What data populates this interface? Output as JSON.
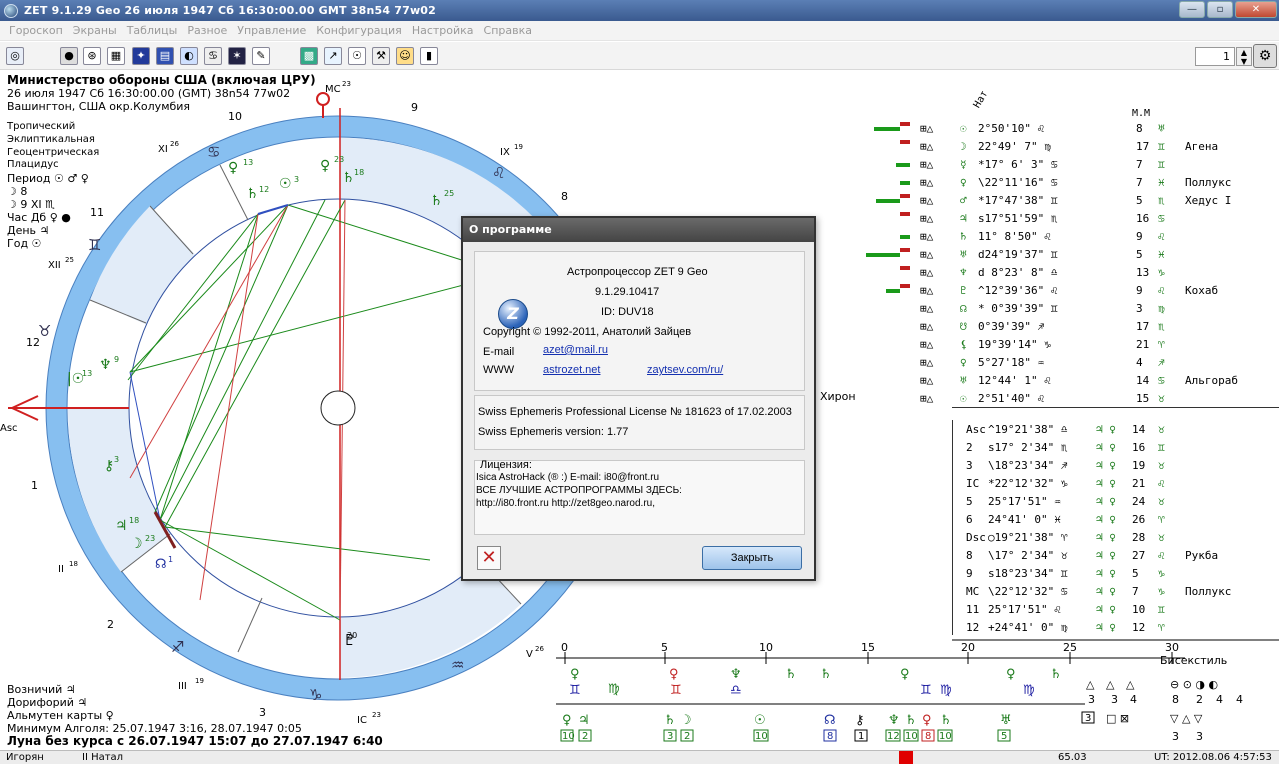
{
  "window": {
    "title": "ZET 9.1.29 Geo    26 июля 1947   Сб   16:30:00.00 GMT 38n54  77w02",
    "buttons": [
      "—",
      "▫",
      "✕"
    ]
  },
  "menu": [
    "Гороскоп",
    "Экраны",
    "Таблицы",
    "Разное",
    "Управление",
    "Конфигурация",
    "Настройка",
    "Справка"
  ],
  "toolbar": {
    "icons": [
      "chart-icon",
      "globe-icon",
      "wheel-icon",
      "grid-icon",
      "stars-icon",
      "table-icon",
      "transit-icon",
      "symbols-icon",
      "aspects-icon",
      "edit-icon",
      "aspect-grid-icon",
      "chart2-icon",
      "sun-icon",
      "tools-icon",
      "person-icon",
      "stats-icon"
    ],
    "page_value": "1"
  },
  "info": {
    "org": "Министерство обороны США (включая ЦРУ)",
    "date": "26 июля 1947  Сб  16:30:00.00 (GMT) 38n54  77w02",
    "place": "Вашингтон, США окр.Колумбия",
    "settings": [
      "Тропический",
      "Эклиптикальная",
      "Геоцентрическая",
      "Плацидус"
    ],
    "period": "Период ☉ ♂ ♀",
    "row1": "☽ 8",
    "row2": "☽ 9 XI ♏",
    "hour": "Час Дб ♀ ●",
    "day": "День ♃",
    "year": "Год ☉"
  },
  "bottom_info": {
    "l1": "Возничий ♃",
    "l2": "Дорифорий ♃",
    "l3": "Альмутен карты ♀",
    "l4": "Минимум Алголя: 25.07.1947  3:16, 28.07.1947  0:05",
    "l5": "Луна без курса с 26.07.1947 15:07 до 27.07.1947  6:40"
  },
  "wheel": {
    "house_numbers": [
      "10",
      "9",
      "8",
      "12",
      "1",
      "2",
      "3",
      "11"
    ],
    "cusps": [
      "MC23",
      "IX19",
      "XI26",
      "XII25",
      "II18",
      "III19",
      "IC23",
      "V26",
      "Asc"
    ],
    "side_label": "Хирон"
  },
  "right_table": {
    "header_nat": "Нат",
    "header_mm": "М.М",
    "rows": [
      {
        "sym": "☉",
        "pos": " 2°50'10\" ♌",
        "n": "8",
        "mark": "♅",
        "star": ""
      },
      {
        "sym": "☽",
        "pos": "22°49' 7\" ♍",
        "n": "17",
        "mark": "♊",
        "star": "Агена"
      },
      {
        "sym": "☿",
        "pos": "*17° 6' 3\" ♋",
        "n": "7",
        "mark": "♊",
        "star": ""
      },
      {
        "sym": "♀",
        "pos": "\\22°11'16\" ♋",
        "n": "7",
        "mark": "♓",
        "star": "Поллукс"
      },
      {
        "sym": "♂",
        "pos": "*17°47'38\" ♊",
        "n": "5",
        "mark": "♏",
        "star": "Хедус I"
      },
      {
        "sym": "♃",
        "pos": "s17°51'59\" ♏",
        "n": "16",
        "mark": "♋",
        "star": ""
      },
      {
        "sym": "♄",
        "pos": " 11° 8'50\" ♌",
        "n": "9",
        "mark": "♌",
        "star": ""
      },
      {
        "sym": "♅",
        "pos": "d24°19'37\" ♊",
        "n": "5",
        "mark": "♓",
        "star": ""
      },
      {
        "sym": "♆",
        "pos": "d 8°23' 8\" ♎",
        "n": "13",
        "mark": "♑",
        "star": ""
      },
      {
        "sym": "♇",
        "pos": "^12°39'36\" ♌",
        "n": "9",
        "mark": "♌",
        "star": "Кохаб"
      },
      {
        "sym": "☊",
        "pos": "* 0°39'39\" ♊",
        "n": "3",
        "mark": "♍",
        "star": ""
      },
      {
        "sym": "☋",
        "pos": " 0°39'39\" ♐",
        "n": "17",
        "mark": "♏",
        "star": ""
      },
      {
        "sym": "⚸",
        "pos": " 19°39'14\" ♑",
        "n": "21",
        "mark": "♈",
        "star": ""
      },
      {
        "sym": "♀",
        "pos": " 5°27'18\" ♒",
        "n": "4",
        "mark": "♐",
        "star": ""
      },
      {
        "sym": "♅",
        "pos": " 12°44' 1\" ♌",
        "n": "14",
        "mark": "♋",
        "star": "Альгораб"
      },
      {
        "sym": "☉",
        "pos": " 2°51'40\" ♌",
        "n": "15",
        "mark": "♉",
        "star": ""
      }
    ],
    "houses": [
      {
        "h": "Asc",
        "pos": "^19°21'38\" ♎",
        "n": "14",
        "mark": "♉",
        "star": ""
      },
      {
        "h": "2",
        "pos": "s17° 2'34\" ♏",
        "n": "16",
        "mark": "♊",
        "star": ""
      },
      {
        "h": "3",
        "pos": "\\18°23'34\" ♐",
        "n": "19",
        "mark": "♉",
        "star": ""
      },
      {
        "h": "IC",
        "pos": "*22°12'32\" ♑",
        "n": "21",
        "mark": "♌",
        "star": ""
      },
      {
        "h": "5",
        "pos": " 25°17'51\" ♒",
        "n": "24",
        "mark": "♉",
        "star": ""
      },
      {
        "h": "6",
        "pos": " 24°41' 0\" ♓",
        "n": "26",
        "mark": "♈",
        "star": ""
      },
      {
        "h": "Dsc",
        "pos": "○19°21'38\" ♈",
        "n": "28",
        "mark": "♉",
        "star": ""
      },
      {
        "h": "8",
        "pos": "\\17° 2'34\" ♉",
        "n": "27",
        "mark": "♌",
        "star": "Рукба"
      },
      {
        "h": "9",
        "pos": "s18°23'34\" ♊",
        "n": "5",
        "mark": "♑",
        "star": ""
      },
      {
        "h": "MC",
        "pos": "\\22°12'32\" ♋",
        "n": "7",
        "mark": "♑",
        "star": "Поллукс"
      },
      {
        "h": "11",
        "pos": " 25°17'51\" ♌",
        "n": "10",
        "mark": "♊",
        "star": ""
      },
      {
        "h": "12",
        "pos": "+24°41' 0\" ♍",
        "n": "12",
        "mark": "♈",
        "star": ""
      }
    ]
  },
  "timeline": {
    "ticks": [
      "0",
      "5",
      "10",
      "15",
      "20",
      "25",
      "30"
    ],
    "label": "Бисекстиль",
    "bottom_nums": [
      "10",
      "2",
      "3",
      "2",
      "10",
      "8",
      "1",
      "12",
      "10",
      "8",
      "10",
      "5",
      "3"
    ],
    "right_nums": [
      "3",
      "3",
      "4",
      "8",
      "2",
      "4",
      "4",
      "3",
      "3"
    ]
  },
  "status": {
    "left": "Игорян",
    "mid": "II Натал",
    "val": "65.03",
    "time": "UT: 2012.08.06  4:57:53"
  },
  "dialog": {
    "title": "О программе",
    "logo": "Z",
    "app": "Астропроцессор ZET 9  Geo",
    "version": "9.1.29.10417",
    "id": "ID: DUV18",
    "copyright": "Copyright © 1992-2011, Анатолий Зайцев",
    "email_label": "E-mail",
    "email": "azet@mail.ru",
    "www_label": "WWW",
    "site1": "astrozet.net",
    "site2": "zaytsev.com/ru/",
    "license": "Swiss Ephemeris Professional License № 181623 of 17.02.2003",
    "swiss_version": "Swiss Ephemeris version:  1.77",
    "lic_label": "Лицензия:",
    "lic1": "Isica AstroHack (® :)             E-mail: i80@front.ru",
    "lic2": "ВСЕ ЛУЧШИЕ АСТРОПРОГРАММЫ ЗДЕСЬ:",
    "lic3": "http://i80.front.ru          http://zet8geo.narod.ru,",
    "close_label": "Закрыть"
  }
}
